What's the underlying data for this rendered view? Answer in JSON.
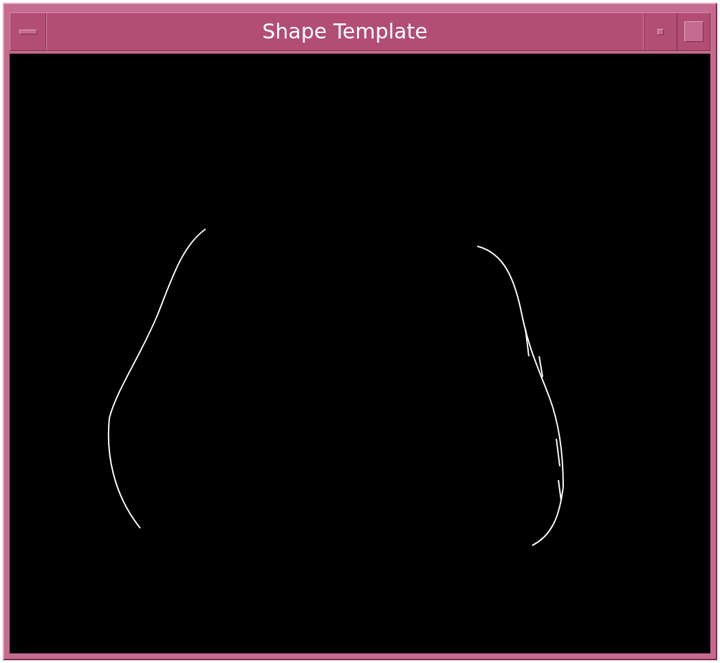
{
  "window": {
    "title": "Shape Template"
  }
}
